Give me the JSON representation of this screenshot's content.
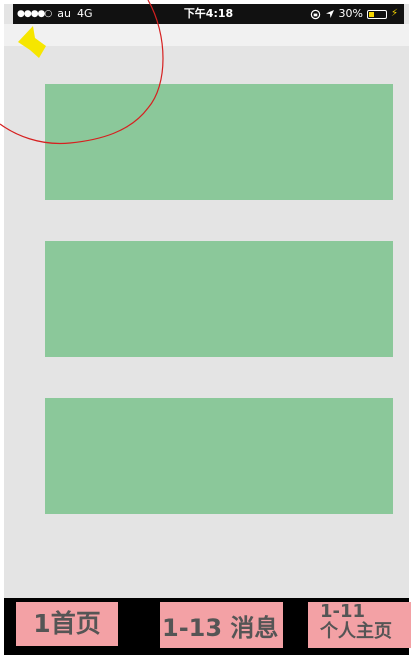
{
  "status_bar": {
    "signal": "●●●●○",
    "carrier": "au",
    "network": "4G",
    "time": "下午4:18",
    "battery_percent": "30%",
    "battery_level": 0.3,
    "icons": [
      "rotation-lock-icon",
      "location-arrow-icon",
      "battery-icon",
      "charging-icon"
    ]
  },
  "navigation": {
    "back_icon": "back-arrow-icon"
  },
  "cards": [
    {
      "name": "card-1"
    },
    {
      "name": "card-2"
    },
    {
      "name": "card-3"
    }
  ],
  "tab_bar": {
    "home": "1首页",
    "messages": "1-13 消息",
    "profile_number": "1-11",
    "profile_label": "个人主页"
  },
  "colors": {
    "card": "#8bc89a",
    "tab": "#f3a1a5",
    "background": "#e4e4e4",
    "status_bar": "#111111",
    "annotation_arrow": "#f6e600",
    "annotation_curve": "#d62020"
  }
}
